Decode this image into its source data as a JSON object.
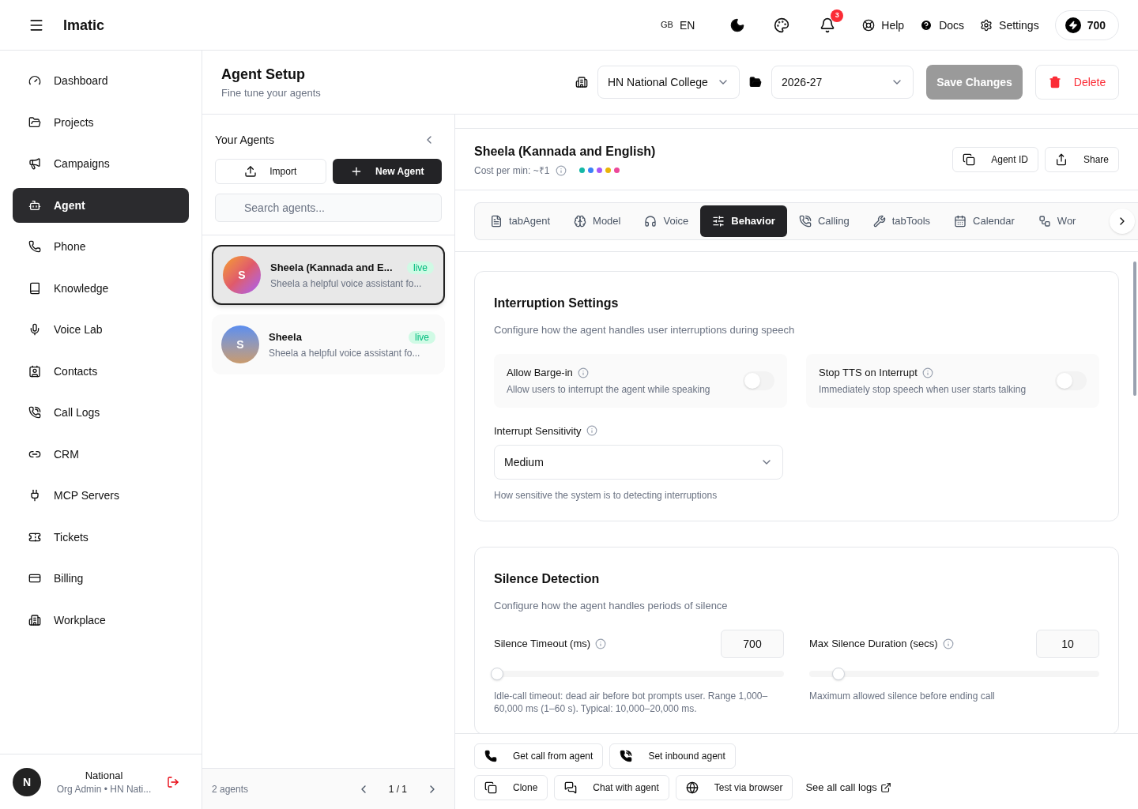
{
  "header": {
    "brand": "Imatic",
    "lang_code": "GB",
    "lang": "EN",
    "notifications": "3",
    "links": [
      "Help",
      "Docs",
      "Settings"
    ],
    "credits": "700"
  },
  "sidebar": {
    "items": [
      {
        "label": "Dashboard",
        "selected": false
      },
      {
        "label": "Projects",
        "selected": false
      },
      {
        "label": "Campaigns",
        "selected": false
      },
      {
        "label": "Agent",
        "selected": true
      },
      {
        "label": "Phone",
        "selected": false
      },
      {
        "label": "Knowledge",
        "selected": false
      },
      {
        "label": "Voice Lab",
        "selected": false
      },
      {
        "label": "Contacts",
        "selected": false
      },
      {
        "label": "Call Logs",
        "selected": false
      },
      {
        "label": "CRM",
        "selected": false
      },
      {
        "label": "MCP Servers",
        "selected": false
      },
      {
        "label": "Tickets",
        "selected": false
      },
      {
        "label": "Billing",
        "selected": false
      },
      {
        "label": "Workplace",
        "selected": false
      }
    ],
    "user": {
      "initial": "N",
      "name": "National",
      "role": "Org Admin • HN Nati..."
    }
  },
  "page": {
    "title": "Agent Setup",
    "subtitle": "Fine tune your agents",
    "org": "HN National College",
    "year": "2026-27",
    "save": "Save Changes",
    "delete": "Delete"
  },
  "agents": {
    "title": "Your Agents",
    "import": "Import",
    "new": "New Agent",
    "search_placeholder": "Search agents...",
    "items": [
      {
        "initial": "S",
        "name": "Sheela (Kannada and E...",
        "desc": "Sheela a helpful voice assistant fo...",
        "status": "live",
        "selected": true
      },
      {
        "initial": "S",
        "name": "Sheela",
        "desc": "Sheela a helpful voice assistant fo...",
        "status": "live",
        "selected": false
      }
    ],
    "count": "2 agents",
    "page": "1 / 1"
  },
  "agent": {
    "name": "Sheela (Kannada and English)",
    "cost": "Cost per min: ~₹1",
    "dots": [
      {
        "color": "#14b8a6"
      },
      {
        "color": "#3b82f6"
      },
      {
        "color": "#a855f7"
      },
      {
        "color": "#eab308"
      },
      {
        "color": "#ec4899"
      }
    ],
    "buttons": [
      "Agent ID",
      "Share"
    ]
  },
  "tabs": [
    {
      "label": "tabAgent",
      "selected": false
    },
    {
      "label": "Model",
      "selected": false
    },
    {
      "label": "Voice",
      "selected": false
    },
    {
      "label": "Behavior",
      "selected": true
    },
    {
      "label": "Calling",
      "selected": false
    },
    {
      "label": "tabTools",
      "selected": false
    },
    {
      "label": "Calendar",
      "selected": false
    },
    {
      "label": "Wor",
      "selected": false
    }
  ],
  "interruption": {
    "title": "Interruption Settings",
    "desc": "Configure how the agent handles user interruptions during speech",
    "toggles": [
      {
        "label": "Allow Barge-in",
        "desc": "Allow users to interrupt the agent while speaking",
        "on": false
      },
      {
        "label": "Stop TTS on Interrupt",
        "desc": "Immediately stop speech when user starts talking",
        "on": false
      }
    ],
    "sensitivity": {
      "label": "Interrupt Sensitivity",
      "value": "Medium",
      "help": "How sensitive the system is to detecting interruptions"
    }
  },
  "silence": {
    "title": "Silence Detection",
    "desc": "Configure how the agent handles periods of silence",
    "sliders": [
      {
        "label": "Silence Timeout (ms)",
        "value": "700",
        "level": 0.01,
        "help": "Idle-call timeout: dead air before bot prompts user. Range 1,000–60,000 ms (1–60 s). Typical: 10,000–20,000 ms."
      },
      {
        "label": "Max Silence Duration (secs)",
        "value": "10",
        "level": 0.1,
        "help": "Maximum allowed silence before ending call"
      }
    ]
  },
  "actions": {
    "row1": [
      "Get call from agent",
      "Set inbound agent"
    ],
    "row2": [
      "Clone",
      "Chat with agent",
      "Test via browser"
    ],
    "link": "See all call logs"
  }
}
